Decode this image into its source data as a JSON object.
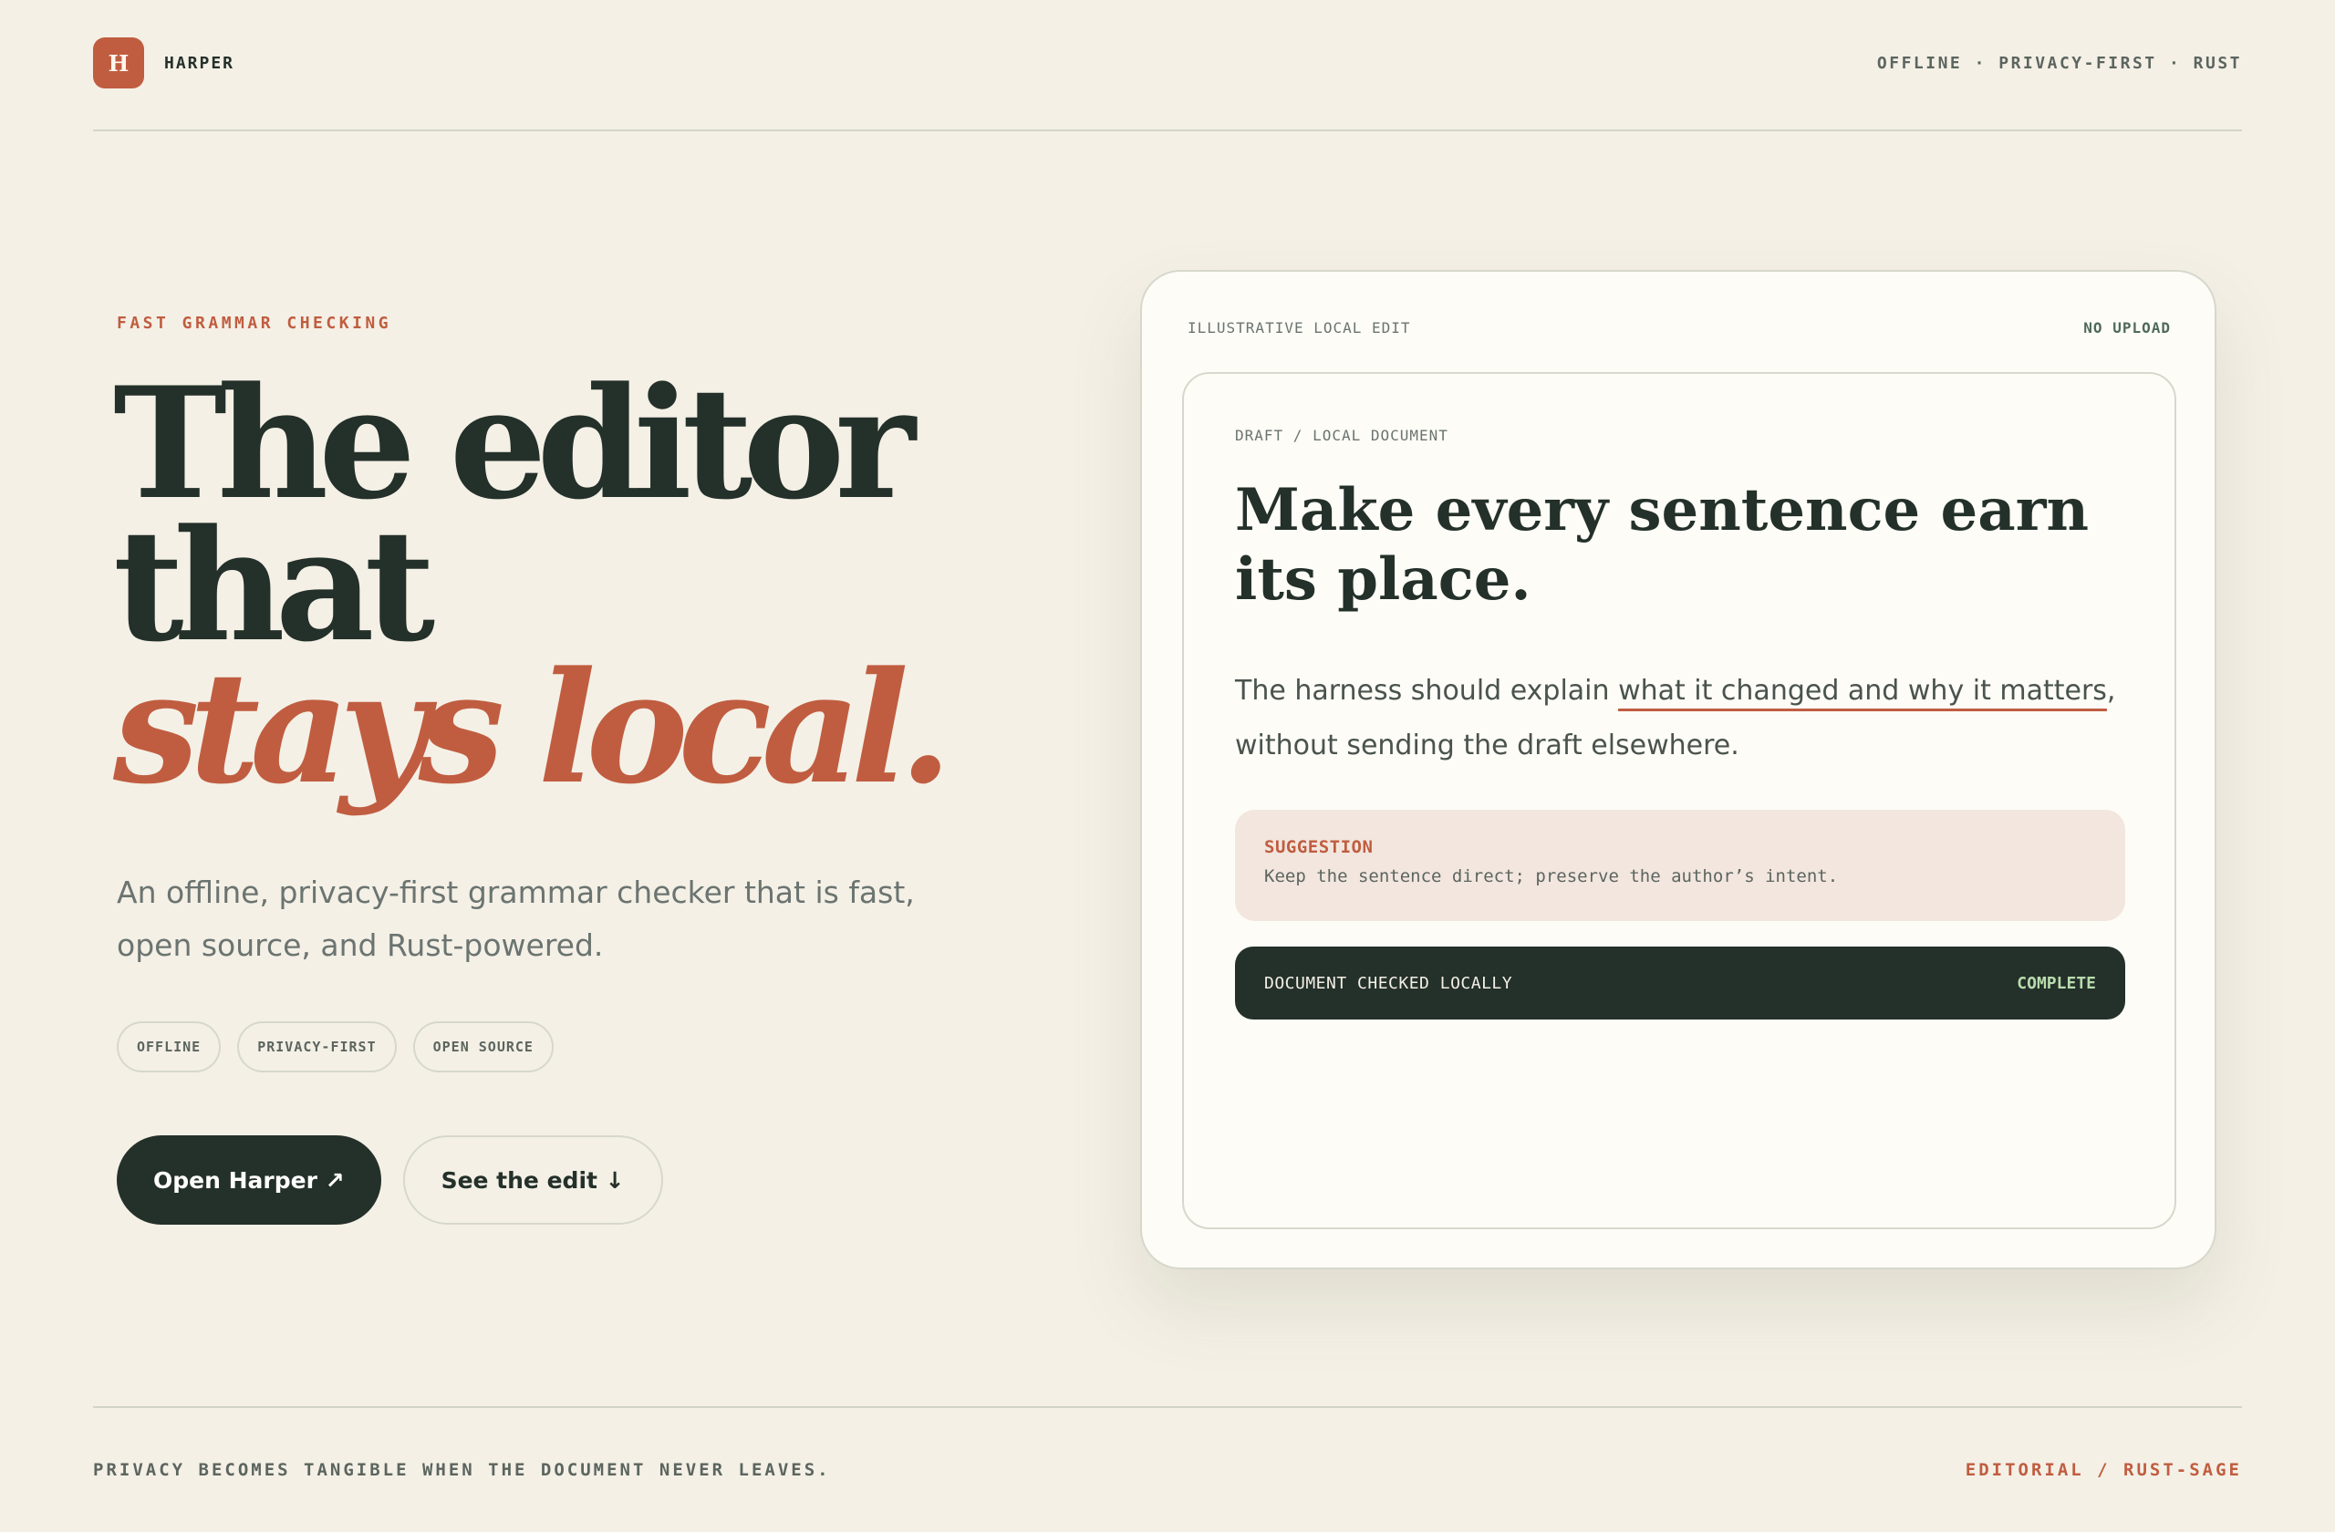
{
  "header": {
    "logo_letter": "H",
    "brand_name": "HARPER",
    "tags": "OFFLINE · PRIVACY-FIRST · RUST"
  },
  "hero": {
    "eyebrow": "FAST GRAMMAR CHECKING",
    "headline_line1": "The editor",
    "headline_line2": "that",
    "headline_accent": "stays local.",
    "lede": "An offline, privacy-first grammar checker that is fast, open source, and Rust-powered.",
    "chips": [
      "OFFLINE",
      "PRIVACY-FIRST",
      "OPEN SOURCE"
    ],
    "primary_cta": "Open Harper ↗",
    "secondary_cta": "See the edit ↓"
  },
  "card": {
    "label": "ILLUSTRATIVE LOCAL EDIT",
    "badge": "NO UPLOAD",
    "doc_label": "DRAFT / LOCAL DOCUMENT",
    "doc_title": "Make every sentence earn its place.",
    "body_before": "The harness should explain ",
    "body_marked": "what it changed and why it matters",
    "body_after": ", without sending the draft elsewhere.",
    "suggestion_title": "SUGGESTION",
    "suggestion_text": "Keep the sentence direct; preserve the author’s intent.",
    "status_text": "DOCUMENT CHECKED LOCALLY",
    "status_value": "COMPLETE"
  },
  "footer": {
    "left": "PRIVACY BECOMES TANGIBLE WHEN THE DOCUMENT NEVER LEAVES.",
    "right": "EDITORIAL / RUST-SAGE"
  },
  "colors": {
    "background": "#f4f0e6",
    "accent": "#c05d40",
    "ink": "#24302a",
    "status_complete": "#b9dcae"
  }
}
